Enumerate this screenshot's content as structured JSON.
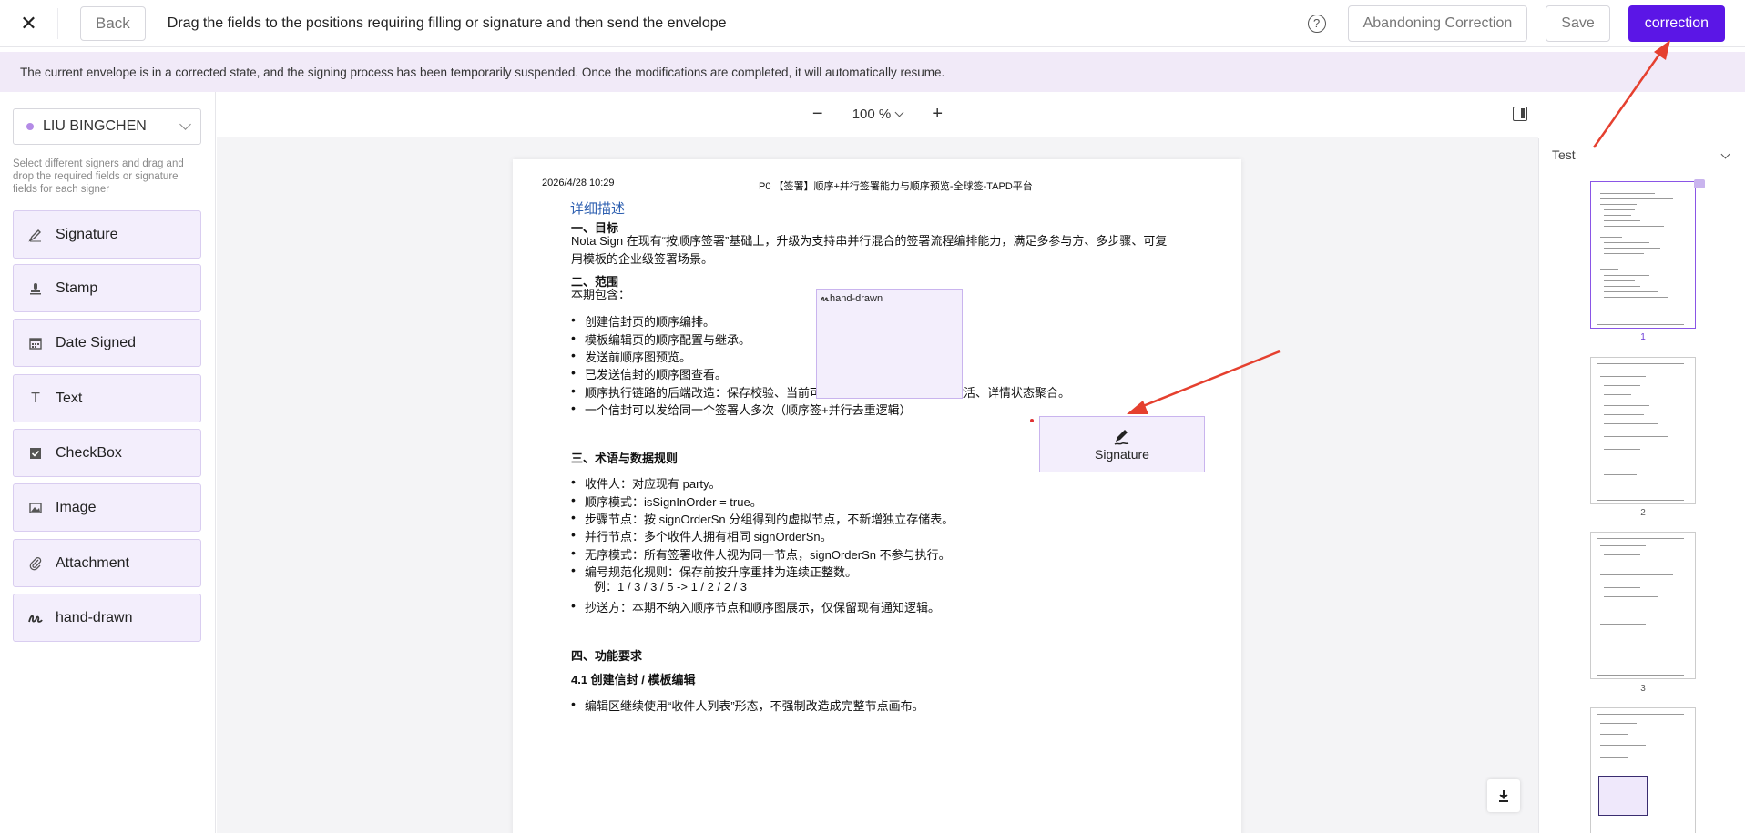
{
  "topbar": {
    "back_label": "Back",
    "title": "Drag the fields to the positions requiring filling or signature and then send the envelope",
    "help_icon": "question-circle-icon",
    "abandon_label": "Abandoning Correction",
    "save_label": "Save",
    "correction_label": "correction",
    "accent_color": "#5b16e6"
  },
  "banner": {
    "text": "The current envelope is in a corrected state, and the signing process has been temporarily suspended. Once the modifications are completed, it will automatically resume."
  },
  "signer": {
    "name": "LIU BINGCHEN",
    "hint": "Select different signers and drag and drop the required fields or signature fields for each signer"
  },
  "fields": [
    {
      "label": "Signature",
      "icon": "pen-icon"
    },
    {
      "label": "Stamp",
      "icon": "stamp-icon"
    },
    {
      "label": "Date Signed",
      "icon": "calendar-icon"
    },
    {
      "label": "Text",
      "icon": "text-icon"
    },
    {
      "label": "CheckBox",
      "icon": "checkbox-icon"
    },
    {
      "label": "Image",
      "icon": "image-icon"
    },
    {
      "label": "Attachment",
      "icon": "paperclip-icon"
    },
    {
      "label": "hand-drawn",
      "icon": "scribble-icon"
    }
  ],
  "zoom": {
    "minus": "−",
    "level": "100 %",
    "plus": "+"
  },
  "document": {
    "date": "2026/4/28 10:29",
    "header": "P0 【签署】顺序+并行签署能力与顺序预览-全球签-TAPD平台",
    "section_title": "详细描述",
    "h1": "一、目标",
    "p1_line1": "Nota Sign 在现有“按顺序签署”基础上，升级为支持串并行混合的签署流程编排能力，满足多参与方、多步骤、可复",
    "p1_line2": "用模板的企业级签署场景。",
    "h2": "二、范围",
    "p2": "本期包含：",
    "scope_items": [
      "创建信封页的顺序编排。",
      "模板编辑页的顺序配置与继承。",
      "发送前顺序图预览。",
      "已发送信封的顺序图查看。",
      "顺序执行链路的后端改造：保存校验、当前可处理节点判定、下一节点激活、详情状态聚合。",
      "一个信封可以发给同一个签署人多次（顺序签+并行去重逻辑）"
    ],
    "h3": "三、术语与数据规则",
    "term_items": [
      "收件人：对应现有 party。",
      "顺序模式：isSignInOrder = true。",
      "步骤节点：按 signOrderSn 分组得到的虚拟节点，不新增独立存储表。",
      "并行节点：多个收件人拥有相同 signOrderSn。",
      "无序模式：所有签署收件人视为同一节点，signOrderSn 不参与执行。",
      "编号规范化规则：保存前按升序重排为连续正整数。"
    ],
    "example": "例：1 / 3 / 3 / 5 -> 1 / 2 / 2 / 3",
    "term_last": "抄送方：本期不纳入顺序节点和顺序图展示，仅保留现有通知逻辑。",
    "h4": "四、功能要求",
    "h41": "4.1 创建信封 / 模板编辑",
    "last_item": "编辑区继续使用“收件人列表”形态，不强制改造成完整节点画布。"
  },
  "placed_fields": {
    "hand_drawn_label": "hand-drawn",
    "signature_label": "Signature"
  },
  "thumbnails": {
    "doc_name": "Test",
    "pages": [
      "1",
      "2",
      "3"
    ]
  }
}
